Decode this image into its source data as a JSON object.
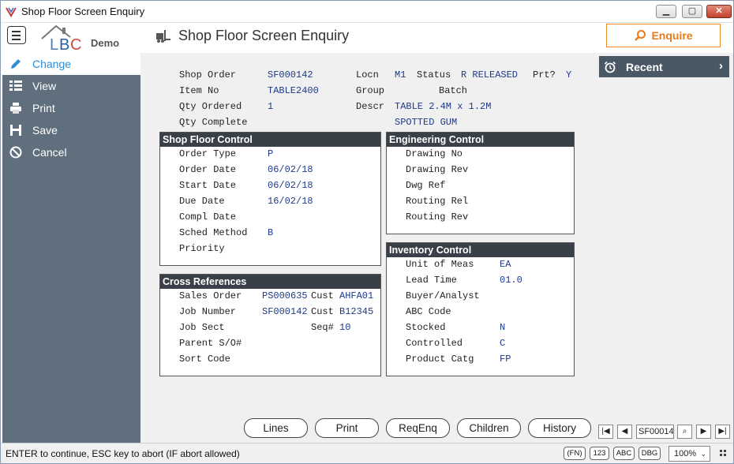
{
  "window": {
    "title": "Shop Floor Screen Enquiry"
  },
  "header": {
    "logo_demo": "Demo",
    "title": "Shop Floor Screen Enquiry",
    "enquire_label": "Enquire"
  },
  "sidebar": {
    "items": [
      {
        "label": "Change",
        "icon": "pencil-icon"
      },
      {
        "label": "View",
        "icon": "list-icon"
      },
      {
        "label": "Print",
        "icon": "printer-icon"
      },
      {
        "label": "Save",
        "icon": "floppy-icon"
      },
      {
        "label": "Cancel",
        "icon": "cancel-icon"
      }
    ]
  },
  "recent": {
    "label": "Recent"
  },
  "top": {
    "shop_order_label": "Shop Order",
    "shop_order": "SF000142",
    "item_no_label": "Item No",
    "item_no": "TABLE2400",
    "qty_ordered_label": "Qty Ordered",
    "qty_ordered": "1",
    "qty_complete_label": "Qty Complete",
    "locn_label": "Locn",
    "locn": "M1",
    "status_label": "Status",
    "status": "R RELEASED",
    "prt_label": "Prt?",
    "prt": "Y",
    "group_label": "Group",
    "group": "Batch",
    "descr_label": "Descr",
    "descr1": "TABLE 2.4M x 1.2M",
    "descr2": "SPOTTED GUM"
  },
  "shop_floor_control": {
    "heading": "Shop Floor Control",
    "order_type_label": "Order Type",
    "order_type": "P",
    "order_date_label": "Order Date",
    "order_date": "06/02/18",
    "start_date_label": "Start Date",
    "start_date": "06/02/18",
    "due_date_label": "Due Date",
    "due_date": "16/02/18",
    "compl_date_label": "Compl Date",
    "sched_method_label": "Sched Method",
    "sched_method": "B",
    "priority_label": "Priority"
  },
  "engineering_control": {
    "heading": "Engineering Control",
    "drawing_no_label": "Drawing No",
    "drawing_rev_label": "Drawing Rev",
    "dwg_ref_label": "Dwg Ref",
    "routing_rel_label": "Routing Rel",
    "routing_rev_label": "Routing Rev"
  },
  "cross_references": {
    "heading": "Cross References",
    "sales_order_label": "Sales Order",
    "sales_order": "PS000635",
    "cust_label": "Cust",
    "sales_cust": "AHFA01",
    "job_number_label": "Job Number",
    "job_number": "SF000142",
    "job_cust": "B12345",
    "job_sect_label": "Job Sect",
    "seq_label": "Seq#",
    "seq": "10",
    "parent_label": "Parent S/O#",
    "sort_code_label": "Sort Code"
  },
  "inventory_control": {
    "heading": "Inventory Control",
    "unit_label": "Unit of Meas",
    "unit": "EA",
    "lead_time_label": "Lead Time",
    "lead_time": "01.0",
    "buyer_label": "Buyer/Analyst",
    "abc_label": "ABC Code",
    "stocked_label": "Stocked",
    "stocked": "N",
    "controlled_label": "Controlled",
    "controlled": "C",
    "catg_label": "Product Catg",
    "catg": "FP"
  },
  "bottom_buttons": {
    "lines": "Lines",
    "print": "Print",
    "reqenq": "ReqEnq",
    "children": "Children",
    "history": "History"
  },
  "nav": {
    "record": "SF00014"
  },
  "status": {
    "message": "ENTER to continue, ESC key to abort (IF abort allowed)",
    "fn": "(FN)",
    "num": "123",
    "abc": "ABC",
    "dbg": "DBG",
    "zoom": "100%"
  },
  "colors": {
    "sidebar": "#5f6f7e",
    "accent": "#2a8fd6",
    "enquire": "#e87b1c",
    "panel_header": "#3a4048",
    "value": "#1f3a8a"
  }
}
